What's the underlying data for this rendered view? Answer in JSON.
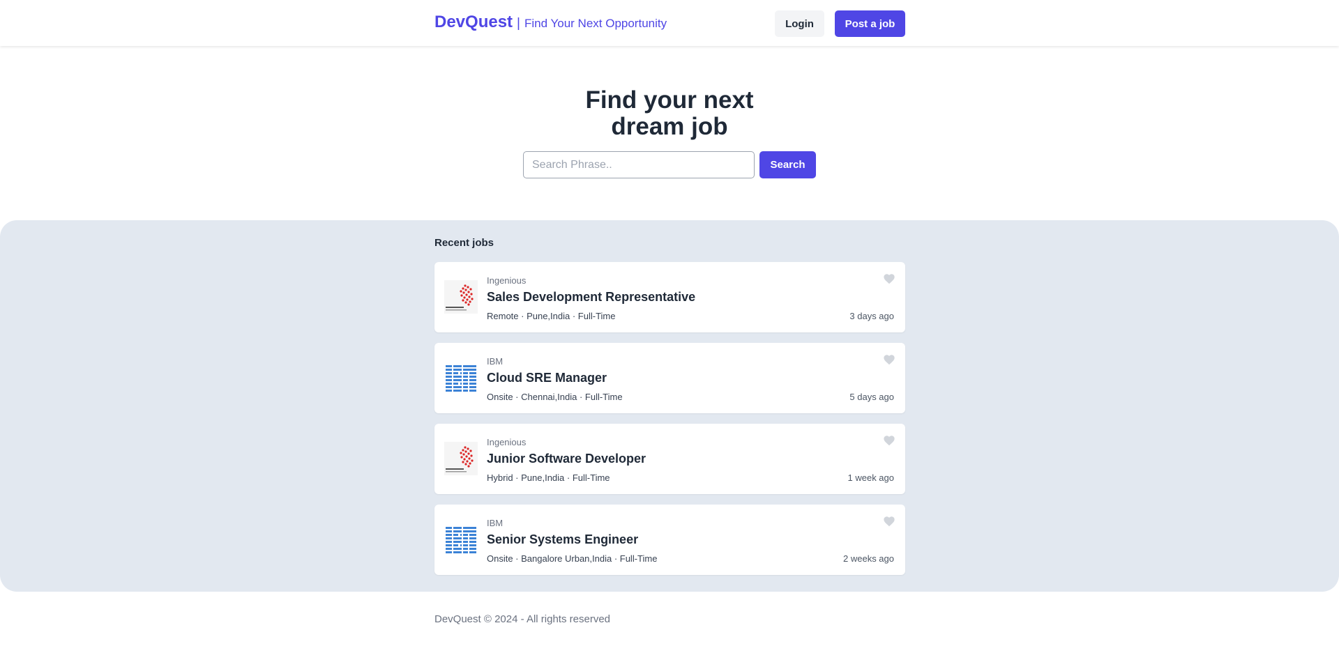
{
  "header": {
    "brand": "DevQuest",
    "separator": "|",
    "tagline": "Find Your Next Opportunity",
    "login_label": "Login",
    "post_job_label": "Post a job"
  },
  "hero": {
    "title_line1": "Find your next",
    "title_line2": "dream job",
    "search_placeholder": "Search Phrase..",
    "search_value": "",
    "search_button": "Search"
  },
  "jobs": {
    "section_title": "Recent jobs",
    "items": [
      {
        "company": "Ingenious",
        "logo": "ingenious-logo",
        "title": "Sales Development Representative",
        "meta": "Remote · Pune,India · Full-Time",
        "posted": "3 days ago"
      },
      {
        "company": "IBM",
        "logo": "ibm-logo",
        "title": "Cloud SRE Manager",
        "meta": "Onsite · Chennai,India · Full-Time",
        "posted": "5 days ago"
      },
      {
        "company": "Ingenious",
        "logo": "ingenious-logo",
        "title": "Junior Software Developer",
        "meta": "Hybrid · Pune,India · Full-Time",
        "posted": "1 week ago"
      },
      {
        "company": "IBM",
        "logo": "ibm-logo",
        "title": "Senior Systems Engineer",
        "meta": "Onsite · Bangalore Urban,India · Full-Time",
        "posted": "2 weeks ago"
      }
    ]
  },
  "footer": {
    "text": "DevQuest © 2024 - All rights reserved"
  },
  "colors": {
    "accent": "#4f46e5",
    "section_bg": "#e2e8f0",
    "ibm_blue": "#3b82d6",
    "ingenious_red": "#dc2626"
  }
}
